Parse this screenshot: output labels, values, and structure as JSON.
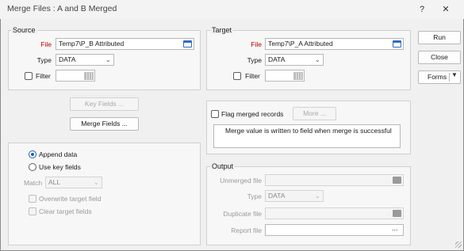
{
  "window": {
    "title": "Merge Files : A and B Merged",
    "help_glyph": "?",
    "close_glyph": "✕"
  },
  "source": {
    "legend": "Source",
    "file_label": "File",
    "file_value": "Temp7\\P_B Attributed",
    "type_label": "Type",
    "type_value": "DATA",
    "filter_label": "Filter"
  },
  "target": {
    "legend": "Target",
    "file_label": "File",
    "file_value": "Temp7\\P_A Attributed",
    "type_label": "Type",
    "type_value": "DATA",
    "filter_label": "Filter"
  },
  "buttons": {
    "key_fields": "Key Fields ...",
    "merge_fields": "Merge Fields ...",
    "run": "Run",
    "close": "Close",
    "forms": "Forms",
    "more": "More ..."
  },
  "flag": {
    "label": "Flag merged records",
    "description": "Merge value is written to field when merge is successful"
  },
  "mode": {
    "append_label": "Append data",
    "use_key_label": "Use key fields",
    "match_label": "Match",
    "match_value": "ALL",
    "overwrite_label": "Overwrite target field",
    "clear_label": "Clear target fields",
    "selected": "append"
  },
  "output": {
    "legend": "Output",
    "unmerged_label": "Unmerged file",
    "type_label": "Type",
    "type_value": "DATA",
    "duplicate_label": "Duplicate file",
    "report_label": "Report file",
    "report_button": "..."
  },
  "colors": {
    "accent": "#1a5fb4",
    "required_label": "#c00000"
  }
}
